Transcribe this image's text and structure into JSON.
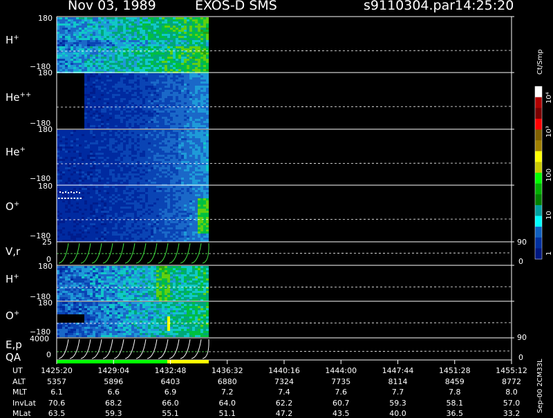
{
  "header": {
    "date": "Nov 03, 1989",
    "instrument": "EXOS-D SMS",
    "file": "s9110304.par",
    "time": "14:25:20"
  },
  "panels": [
    {
      "base": "H",
      "sup": "+",
      "ytop": "180",
      "ybot": "−180"
    },
    {
      "base": "He",
      "sup": "++",
      "ytop": "180",
      "ybot": "−180"
    },
    {
      "base": "He",
      "sup": "+",
      "ytop": "180",
      "ybot": "−180"
    },
    {
      "base": "O",
      "sup": "+",
      "ytop": "180",
      "ybot": "−180"
    },
    {
      "base": "V,r",
      "sup": "",
      "ytop": "25",
      "ybot": "0",
      "rtop": "90",
      "rbot": "0"
    },
    {
      "base": "H",
      "sup": "+",
      "ytop": "180",
      "ybot": "−180"
    },
    {
      "base": "O",
      "sup": "+",
      "ytop": "180",
      "ybot": "−180"
    },
    {
      "base": "E,p",
      "sup": "",
      "ytop": "4000",
      "ybot": "0",
      "rtop": "90",
      "rbot": "0"
    }
  ],
  "qa_label": "QA",
  "colorbar": {
    "unit": "Ct/Smp",
    "labels": [
      "10⁴",
      "10³",
      "100",
      "10",
      "1"
    ],
    "colors": [
      "#ffffff",
      "#b00000",
      "#7a0000",
      "#ff0000",
      "#806000",
      "#a08000",
      "#ffff00",
      "#c8c800",
      "#00ff00",
      "#00b000",
      "#008000",
      "#00a0a0",
      "#00ffff",
      "#1060c0",
      "#0030a0",
      "#001880"
    ]
  },
  "ephemeris": {
    "rows": [
      {
        "label": "UT",
        "values": [
          "1425:20",
          "1429:04",
          "1432:48",
          "1436:32",
          "1440:16",
          "1444:00",
          "1447:44",
          "1451:28",
          "1455:12"
        ]
      },
      {
        "label": "ALT",
        "values": [
          "5357",
          "5896",
          "6403",
          "6880",
          "7324",
          "7735",
          "8114",
          "8459",
          "8772"
        ]
      },
      {
        "label": "MLT",
        "values": [
          "6.1",
          "6.6",
          "6.9",
          "7.2",
          "7.4",
          "7.6",
          "7.7",
          "7.8",
          "8.0"
        ]
      },
      {
        "label": "InvLat",
        "values": [
          "70.6",
          "68.2",
          "66.0",
          "64.0",
          "62.2",
          "60.7",
          "59.3",
          "58.1",
          "57.0"
        ]
      },
      {
        "label": "MLat",
        "values": [
          "63.5",
          "59.3",
          "55.1",
          "51.1",
          "47.2",
          "43.5",
          "40.0",
          "36.5",
          "33.2"
        ]
      }
    ]
  },
  "version_tag": "Sep-00  2CM33L",
  "chart_data": {
    "type": "heatmap",
    "x_axis": "UT",
    "x_ticks": [
      "1425:20",
      "1429:04",
      "1432:48",
      "1436:32",
      "1440:16",
      "1444:00",
      "1447:44",
      "1451:28",
      "1455:12"
    ],
    "data_coverage": {
      "start": "1425:20",
      "end": "1435:00"
    },
    "qa_bar": [
      {
        "from": "1425:20",
        "to": "1432:48",
        "color": "#00ff00"
      },
      {
        "from": "1432:48",
        "to": "1435:00",
        "color": "#ffff00"
      }
    ],
    "colorscale": {
      "unit": "Ct/Smp",
      "range": [
        1,
        10000
      ],
      "log": true
    }
  }
}
